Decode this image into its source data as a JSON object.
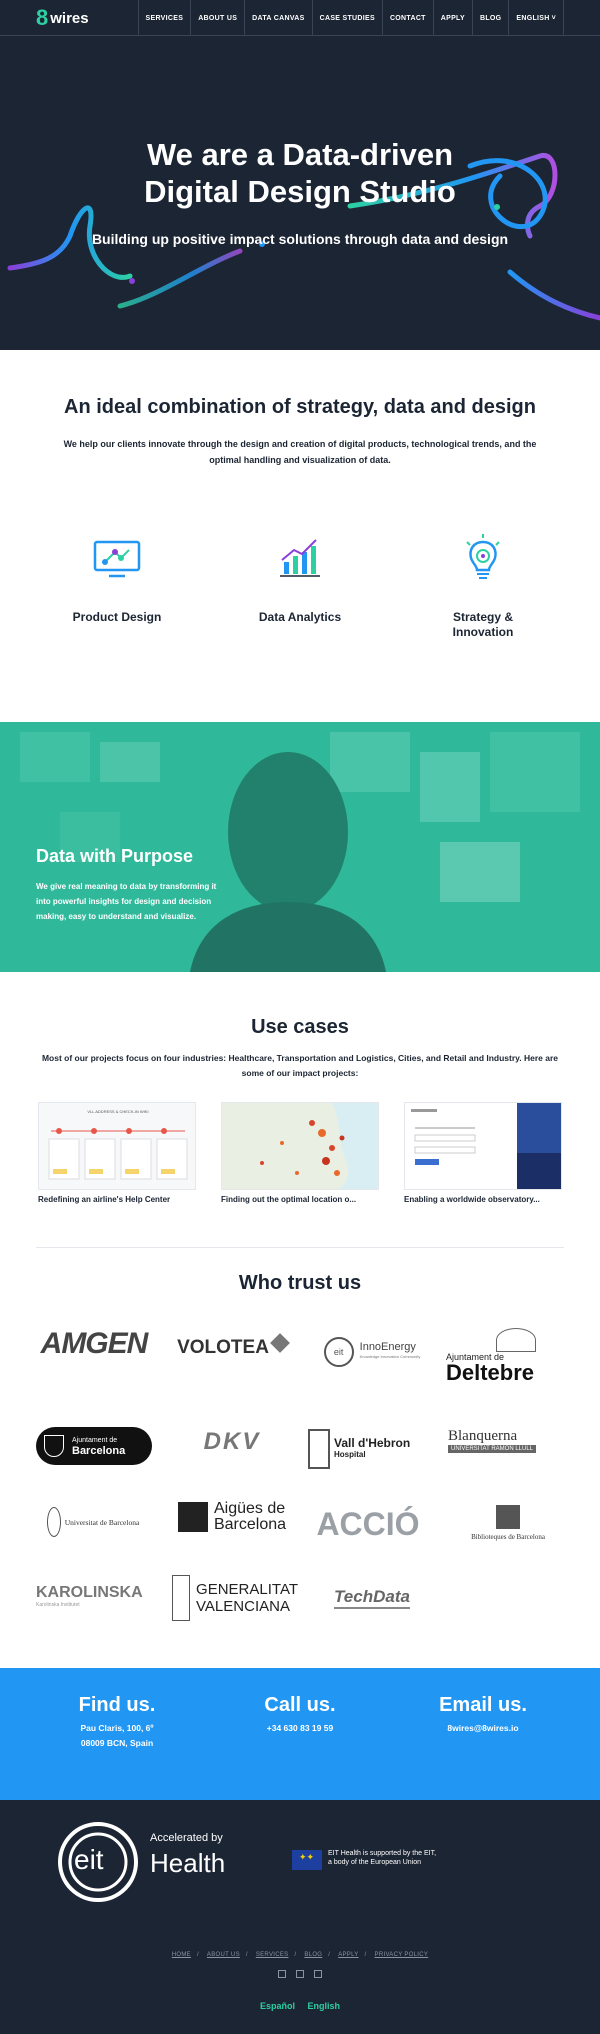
{
  "nav": {
    "logo_mark": "8",
    "logo_text": "wires",
    "items": [
      "SERVICES",
      "ABOUT US",
      "DATA CANVAS",
      "CASE STUDIES",
      "CONTACT",
      "APPLY",
      "BLOG",
      "ENGLISH"
    ]
  },
  "hero": {
    "title_line1": "We are a Data-driven",
    "title_line2": "Digital Design Studio",
    "subtitle": "Building up positive impact solutions through data and design"
  },
  "combo": {
    "title": "An ideal combination of strategy, data and design",
    "text": "We help our clients innovate through the design and creation of digital products, technological trends, and the optimal handling and visualization of data.",
    "services": [
      "Product Design",
      "Data Analytics",
      "Strategy & Innovation"
    ]
  },
  "purpose": {
    "title": "Data with Purpose",
    "text": "We give real meaning to data by transforming it into powerful insights for design and decision making, easy to understand and visualize."
  },
  "usecases": {
    "title": "Use cases",
    "text": "Most of our projects focus on four industries: Healthcare, Transportation and Logistics, Cities, and Retail and Industry. Here are some of our impact projects:",
    "cases": [
      {
        "title": "Redefining an airline's Help Center"
      },
      {
        "title": "Finding out the optimal location o..."
      },
      {
        "title": "Enabling a worldwide observatory..."
      }
    ],
    "thumb1_heading": "VLL ADDRESS & CHECK-IN WIKI"
  },
  "trust": {
    "title": "Who trust us",
    "logos": [
      "AMGEN",
      "VOLOTEA",
      "InnoEnergy",
      "Ajuntament de Deltebre",
      "Ajuntament de Barcelona",
      "DKV",
      "Vall d'Hebron Hospital",
      "Blanquerna",
      "Universitat de Barcelona",
      "Aigües de Barcelona",
      "ACCIÓ",
      "Biblioteques de Barcelona",
      "KAROLINSKA",
      "GENERALITAT VALENCIANA",
      "TechData"
    ],
    "logo_sub": {
      "innoenergy": "Knowledge Innovation Community",
      "deltebre_small": "Ajuntament de",
      "deltebre_big": "Deltebre",
      "bcn_small": "Ajuntament de",
      "bcn_big": "Barcelona",
      "vall_big": "Vall d'Hebron",
      "vall_small": "Hospital",
      "blanq_big": "Blanquerna",
      "blanq_small": "UNIVERSITAT RAMON LLULL",
      "ub_big": "Universitat de Barcelona",
      "aigues_1": "Aigües de",
      "aigues_2": "Barcelona",
      "bib": "Biblioteques de Barcelona",
      "karol_small": "Karolinska Institutet",
      "gen_1": "GENERALITAT",
      "gen_2": "VALENCIANA"
    }
  },
  "contact": {
    "find_title": "Find us.",
    "find_line1": "Pau Claris, 100, 6º",
    "find_line2": "08009 BCN, Spain",
    "call_title": "Call us.",
    "call_text": "+34 630 83 19 59",
    "email_title": "Email us.",
    "email_text": "8wires@8wires.io"
  },
  "footer": {
    "eit_text": "eit",
    "accelerated": "Accelerated by",
    "health": "Health",
    "eu_line1": "EIT Health is supported by the EIT,",
    "eu_line2": "a body of the European Union",
    "links": [
      "HOME",
      "ABOUT US",
      "SERVICES",
      "BLOG",
      "APPLY",
      "PRIVACY POLICY"
    ],
    "sep": "/",
    "languages": [
      "Español",
      "English"
    ]
  },
  "colors": {
    "navy": "#1c2533",
    "teal": "#2dd0a3",
    "blue": "#2196f3",
    "purple": "#8b3fd9"
  }
}
